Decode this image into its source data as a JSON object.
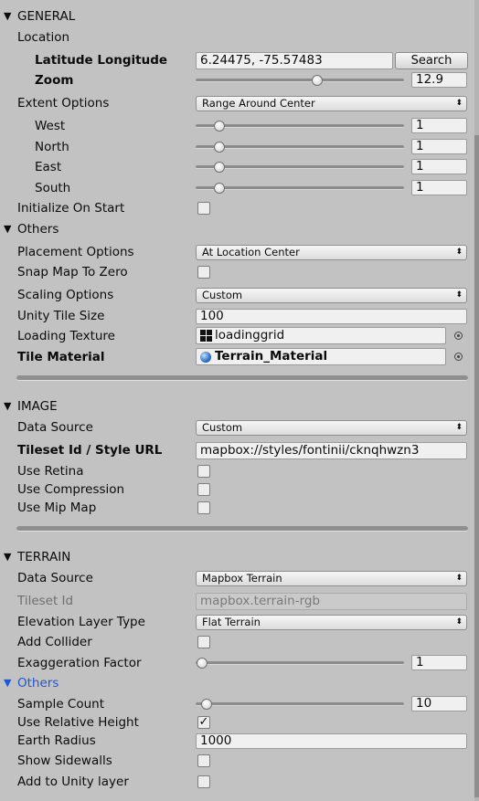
{
  "general": {
    "header": "GENERAL",
    "location_label": "Location",
    "latlon_label": "Latitude Longitude",
    "latlon_value": "6.24475, -75.57483",
    "search_label": "Search",
    "zoom_label": "Zoom",
    "zoom_value": "12.9",
    "zoom_fraction": 0.582,
    "extent_label": "Extent Options",
    "extent_value": "Range Around Center",
    "extent_rows": [
      {
        "label": "West",
        "value": "1"
      },
      {
        "label": "North",
        "value": "1"
      },
      {
        "label": "East",
        "value": "1"
      },
      {
        "label": "South",
        "value": "1"
      }
    ],
    "init_label": "Initialize On Start",
    "init_checked": false
  },
  "others": {
    "header": "Others",
    "placement_label": "Placement Options",
    "placement_value": "At Location Center",
    "snap_label": "Snap Map To Zero",
    "scaling_label": "Scaling Options",
    "scaling_value": "Custom",
    "tile_size_label": "Unity Tile Size",
    "tile_size_value": "100",
    "loading_texture_label": "Loading Texture",
    "loading_texture_value": "loadinggrid",
    "tile_material_label": "Tile Material",
    "tile_material_value": "Terrain_Material"
  },
  "image": {
    "header": "IMAGE",
    "data_source_label": "Data Source",
    "data_source_value": "Custom",
    "tileset_label": "Tileset Id / Style URL",
    "tileset_value": "mapbox://styles/fontinii/cknqhwzn3",
    "retina_label": "Use Retina",
    "compression_label": "Use Compression",
    "mipmap_label": "Use Mip Map"
  },
  "terrain": {
    "header": "TERRAIN",
    "data_source_label": "Data Source",
    "data_source_value": "Mapbox Terrain",
    "tileset_label": "Tileset Id",
    "tileset_value": "mapbox.terrain-rgb",
    "elevation_label": "Elevation Layer Type",
    "elevation_value": "Flat Terrain",
    "collider_label": "Add Collider",
    "exaggeration_label": "Exaggeration Factor",
    "exaggeration_value": "1",
    "others_header": "Others",
    "sample_label": "Sample Count",
    "sample_value": "10",
    "relative_label": "Use Relative Height",
    "relative_checked": true,
    "radius_label": "Earth Radius",
    "radius_value": "1000",
    "sidewalls_label": "Show Sidewalls",
    "layer_label": "Add to Unity layer"
  },
  "icons": {
    "foldout_open": "▼",
    "dropdown_arrow": "▲▼",
    "checkmark": "✓"
  }
}
